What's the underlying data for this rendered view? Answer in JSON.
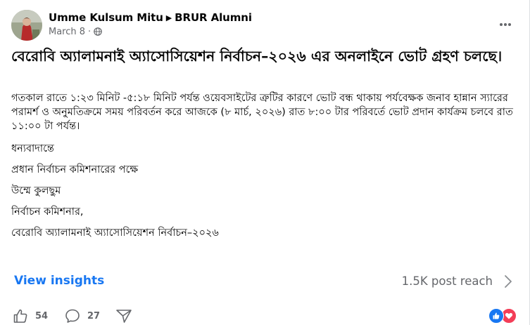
{
  "post": {
    "author": "Umme Kulsum Mitu",
    "group": "BRUR Alumni",
    "date": "March 8",
    "title": "বেরোবি অ্যালামনাই অ্যাসোসিয়েশন নির্বাচন–২০২৬ এর অনলাইনে ভোট গ্রহণ চলছে।",
    "body_paragraph": "গতকাল রাতে ১:২৩ মিনিট -৫:১৮ মিনিট পর্যন্ত ওয়েবসাইটের ত্রুটির কারণে ভোট বন্ধ থাকায় পর্যবেক্ষক জনাব হান্নান স্যারের পরামর্শ ও অনুমতিক্রমে সময় পরিবর্তন করে আজকে (৮ মার্চ, ২০২৬) রাত ৮:০০ টার পরিবর্তে ভোট প্রদান কার্যক্রম চলবে রাত ১১:০০ টা পর্যন্ত।",
    "closing_lines": [
      "ধন্যবাদান্তে",
      "প্রধান নির্বাচন কমিশনারের পক্ষে",
      "উম্মে কুলছুম",
      "নির্বাচন কমিশনার,",
      "বেরোবি অ্যালামনাই অ্যাসোসিয়েশন নির্বাচন–২০২৬"
    ]
  },
  "insights": {
    "link_label": "View insights",
    "reach": "1.5K post reach"
  },
  "actions": {
    "like_count": "54",
    "comment_count": "27"
  },
  "icons": {
    "globe": "globe-icon",
    "more": "more-options-icon",
    "chevron": "chevron-right-icon",
    "like": "like-icon",
    "comment": "comment-icon",
    "share": "share-icon",
    "like_reaction": "like-reaction-icon",
    "love_reaction": "love-reaction-icon"
  },
  "colors": {
    "link_blue": "#1877f2",
    "secondary_text": "#65676b",
    "like_blue": "#1877f2",
    "love_red": "#f33e58"
  }
}
